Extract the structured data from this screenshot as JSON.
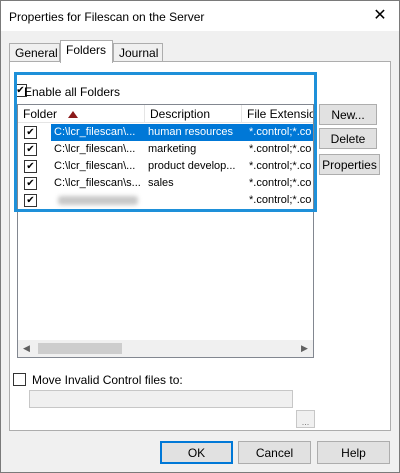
{
  "window": {
    "title": "Properties for Filescan on the Server",
    "close_glyph": "✕"
  },
  "tabs": [
    {
      "label": "General",
      "active": false
    },
    {
      "label": "Folders",
      "active": true
    },
    {
      "label": "Journal",
      "active": false
    }
  ],
  "enable_all": {
    "label": "Enable all Folders",
    "checked": true
  },
  "check_glyph": "✔",
  "list": {
    "columns": [
      "Folder",
      "Description",
      "File Extension"
    ],
    "rows": [
      {
        "checked": true,
        "folder": "C:\\lcr_filescan\\...",
        "description": "human resources",
        "extension": "*.control;*.co",
        "selected": true
      },
      {
        "checked": true,
        "folder": "C:\\lcr_filescan\\...",
        "description": "marketing",
        "extension": "*.control;*.co",
        "selected": false
      },
      {
        "checked": true,
        "folder": "C:\\lcr_filescan\\...",
        "description": "product develop...",
        "extension": "*.control;*.co",
        "selected": false
      },
      {
        "checked": true,
        "folder": "C:\\lcr_filescan\\s...",
        "description": "sales",
        "extension": "*.control;*.co",
        "selected": false
      },
      {
        "checked": true,
        "folder": "",
        "description": "",
        "extension": "*.control;*.co",
        "selected": false,
        "blurred": true
      }
    ],
    "scroll_left_glyph": "◀",
    "scroll_right_glyph": "▶"
  },
  "side_buttons": {
    "new": "New...",
    "delete": "Delete",
    "properties": "Properties"
  },
  "move_invalid": {
    "label": "Move Invalid Control files to:",
    "checked": false,
    "path_value": ""
  },
  "browse_label": "...",
  "footer": {
    "ok": "OK",
    "cancel": "Cancel",
    "help": "Help"
  },
  "colors": {
    "accent": "#0078d7",
    "highlight_frame": "#1e90d9",
    "sort_arrow": "#8b1a1a"
  }
}
